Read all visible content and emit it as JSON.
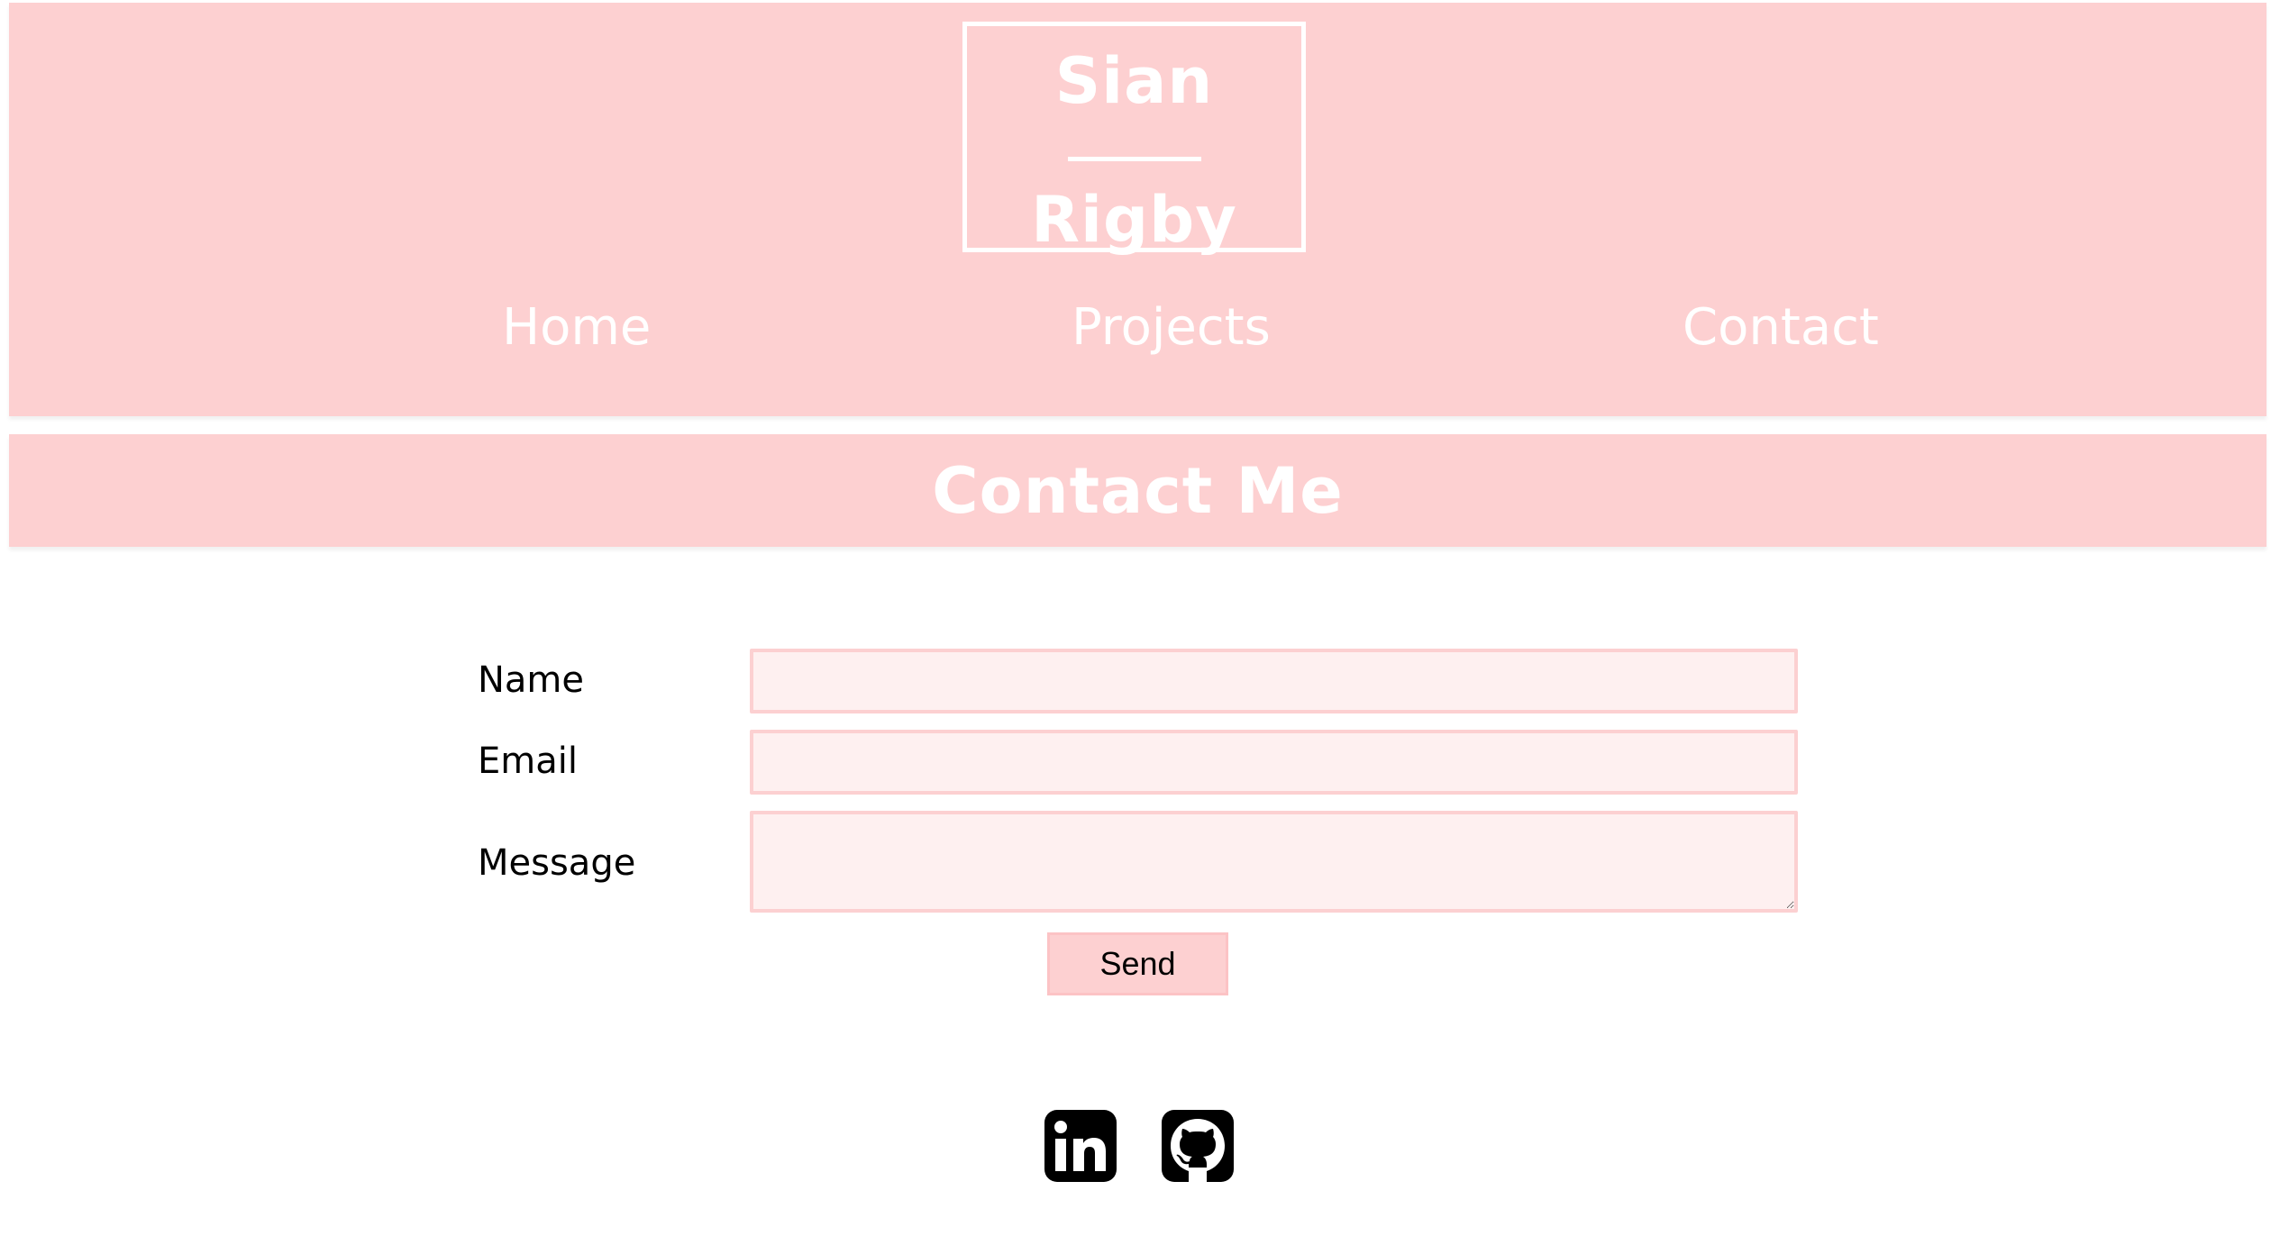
{
  "header": {
    "logo": {
      "first_name": "Sian",
      "last_name": "Rigby"
    },
    "nav": [
      {
        "label": "Home"
      },
      {
        "label": "Projects"
      },
      {
        "label": "Contact"
      }
    ]
  },
  "main": {
    "title": "Contact Me",
    "form": {
      "name_label": "Name",
      "name_value": "",
      "email_label": "Email",
      "email_value": "",
      "message_label": "Message",
      "message_value": "",
      "send_label": "Send"
    }
  },
  "footer": {
    "social_icons": [
      "linkedin-icon",
      "github-icon"
    ]
  },
  "colors": {
    "header_bg": "#fdd0d1",
    "field_bg": "#fef0f0",
    "field_border": "#fcd0d1",
    "text_on_pink": "#ffffff"
  }
}
